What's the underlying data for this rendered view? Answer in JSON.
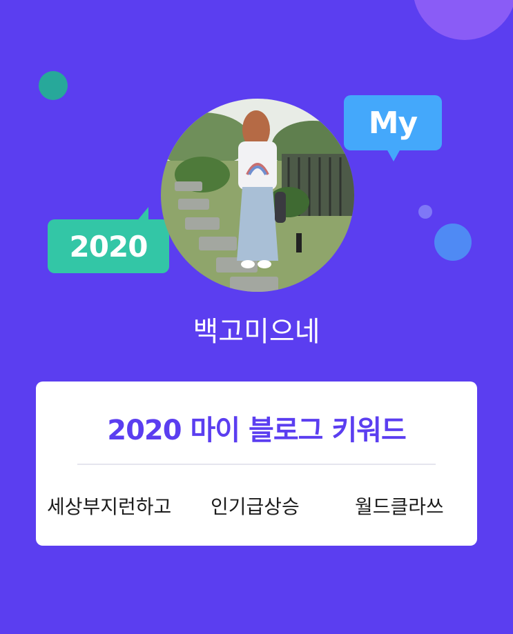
{
  "badges": {
    "my_label": "My",
    "year_label": "2020"
  },
  "profile": {
    "blog_name": "백고미으네"
  },
  "card": {
    "title": "2020 마이 블로그 키워드",
    "keywords": [
      "세상부지런하고",
      "인기급상승",
      "월드클라쓰"
    ]
  },
  "colors": {
    "background": "#5b3ef0",
    "title_accent": "#5b3ef0",
    "my_bubble": "#44a8fb",
    "year_bubble": "#33c6a6"
  }
}
